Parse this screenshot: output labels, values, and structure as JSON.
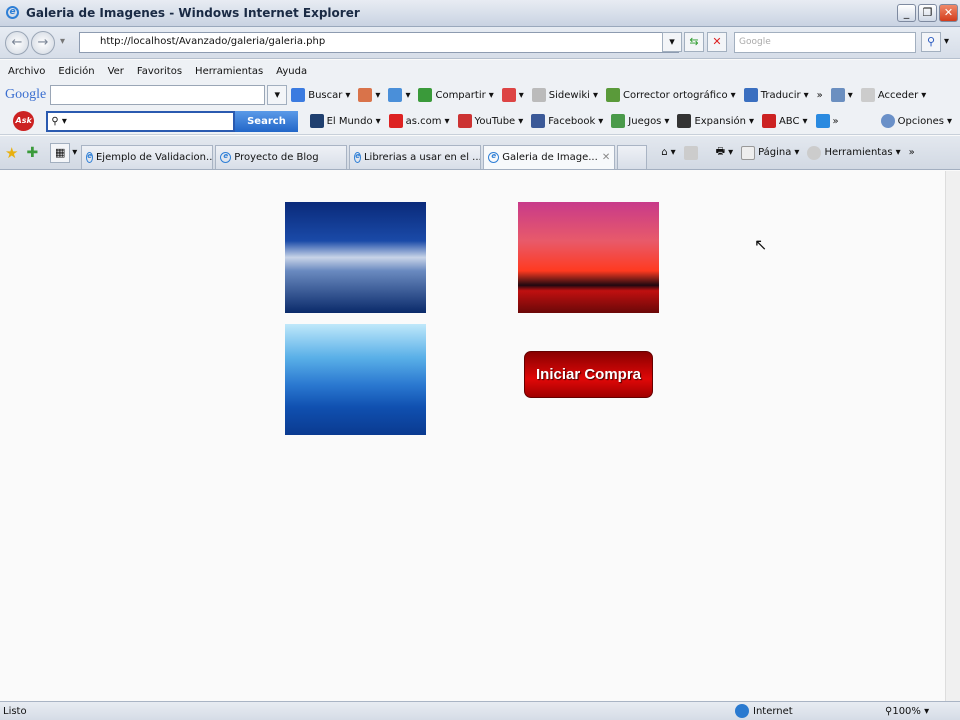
{
  "window": {
    "title": "Galeria de Imagenes - Windows Internet Explorer"
  },
  "address": {
    "url": "http://localhost/Avanzado/galeria/galeria.php",
    "search_placeholder": "Google"
  },
  "menu": [
    "Archivo",
    "Edición",
    "Ver",
    "Favoritos",
    "Herramientas",
    "Ayuda"
  ],
  "google_toolbar": {
    "logo": "Google",
    "items": [
      {
        "label": "Buscar",
        "color": "#3b7be0"
      },
      {
        "label": "",
        "color": "#d9734a"
      },
      {
        "label": "",
        "color": "#4a8fd9"
      },
      {
        "label": "Compartir",
        "color": "#3a9a3a"
      },
      {
        "label": "",
        "color": "#d44"
      },
      {
        "label": "Sidewiki",
        "color": "#bbb"
      },
      {
        "label": "Corrector ortográfico",
        "color": "#5a9a3a"
      },
      {
        "label": "Traducir",
        "color": "#3a6fc0"
      },
      {
        "label": "»",
        "color": ""
      },
      {
        "label": "",
        "color": "#6b8fc0"
      },
      {
        "label": "Acceder",
        "color": "#ccc"
      }
    ]
  },
  "ask_toolbar": {
    "logo": "Ask",
    "search_button": "Search",
    "items": [
      {
        "label": "El Mundo",
        "color": "#1f3f6f"
      },
      {
        "label": "as.com",
        "color": "#d22"
      },
      {
        "label": "YouTube",
        "color": "#c33"
      },
      {
        "label": "Facebook",
        "color": "#3b5998"
      },
      {
        "label": "Juegos",
        "color": "#4a9a4a"
      },
      {
        "label": "Expansión",
        "color": "#333"
      },
      {
        "label": "ABC",
        "color": "#c22"
      },
      {
        "label": "»",
        "color": "#2a8ae0"
      }
    ],
    "options": "Opciones"
  },
  "tabs": [
    {
      "label": "Ejemplo de Validacion..."
    },
    {
      "label": "Proyecto de Blog"
    },
    {
      "label": "Librerias a usar en el ..."
    },
    {
      "label": "Galeria de Image...",
      "active": true
    }
  ],
  "command_bar": {
    "page": "Página",
    "tools": "Herramientas"
  },
  "page": {
    "button": "Iniciar Compra"
  },
  "status": {
    "text": "Listo",
    "zone": "Internet",
    "zoom": "100%"
  }
}
